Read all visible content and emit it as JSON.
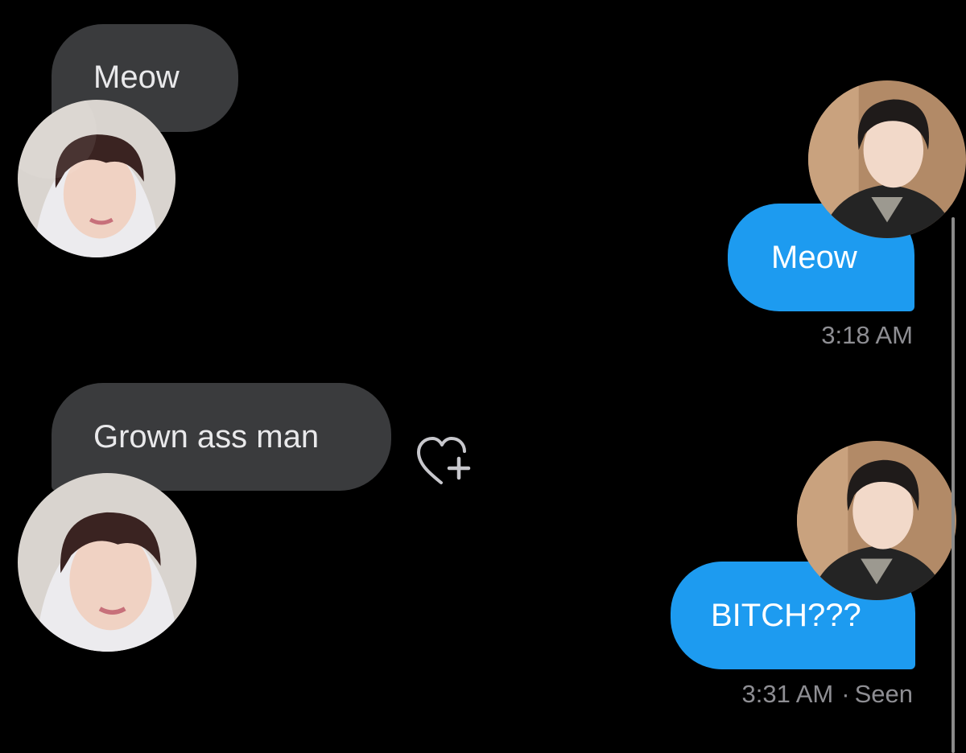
{
  "messages": [
    {
      "text": "Meow",
      "sender": "other"
    },
    {
      "text": "Meow",
      "sender": "me",
      "time": "3:18 AM"
    },
    {
      "text": "Grown ass man",
      "sender": "other"
    },
    {
      "text": "BITCH???",
      "sender": "me",
      "time": "3:31 AM",
      "status": "Seen"
    }
  ],
  "status_separator": "·",
  "icons": {
    "reaction": "heart-plus-icon"
  },
  "colors": {
    "background": "#000000",
    "incoming_bubble": "#3a3b3d",
    "outgoing_bubble": "#1d9bf0",
    "timestamp": "#8e8e93"
  }
}
